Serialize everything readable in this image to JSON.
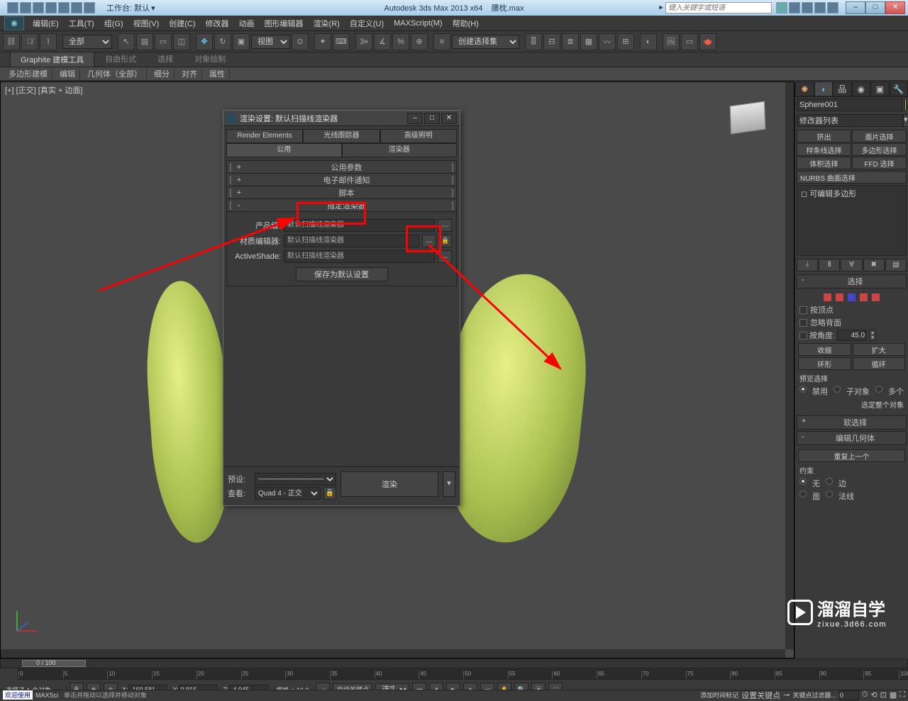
{
  "titlebar": {
    "workspace_label": "工作台: 默认",
    "app": "Autodesk 3ds Max  2013 x64",
    "file": "腰枕.max",
    "search_placeholder": "键入关键字或短语",
    "min": "–",
    "max": "□",
    "close": "✕"
  },
  "menu": [
    "编辑(E)",
    "工具(T)",
    "组(G)",
    "视图(V)",
    "创建(C)",
    "修改器",
    "动画",
    "图形编辑器",
    "渲染(R)",
    "自定义(U)",
    "MAXScript(M)",
    "帮助(H)"
  ],
  "toolbar": {
    "filter_all": "全部",
    "view_label": "视图",
    "create_sel_set": "创建选择集"
  },
  "ribbon": {
    "tabs": [
      "Graphite 建模工具",
      "自由形式",
      "选择",
      "对象绘制"
    ],
    "groups": [
      "多边形建模",
      "编辑",
      "几何体（全部）",
      "细分",
      "对齐",
      "属性"
    ]
  },
  "viewport": {
    "label": "[+] [正交] [真实 + 边面]"
  },
  "cmd": {
    "object_name": "Sphere001",
    "modifier_list": "修改器列表",
    "buttons": [
      "挤出",
      "面片选择",
      "样条线选择",
      "多边形选择",
      "体积选择",
      "FFD 选择"
    ],
    "nurbs": "NURBS 曲面选择",
    "stack_item": "可编辑多边形",
    "rollouts": {
      "selection": "选择",
      "soft": "软选择",
      "editgeo": "编辑几何体"
    },
    "sel": {
      "by_vertex": "按顶点",
      "ignore_back": "忽略背面",
      "by_angle": "按角度:",
      "angle": "45.0",
      "shrink": "收缩",
      "grow": "扩大",
      "ring": "环形",
      "loop": "循环",
      "preview": "预览选择",
      "off": "禁用",
      "subobj": "子对象",
      "multi": "多个",
      "select_whole": "选定整个对象"
    },
    "geo": {
      "repeat": "重复上一个",
      "constraint": "约束",
      "none": "无",
      "edge": "边",
      "face": "面",
      "normal": "法线"
    }
  },
  "dialog": {
    "title": "渲染设置: 默认扫描线渲染器",
    "tabs_top": [
      "Render Elements",
      "光线跟踪器",
      "高级照明"
    ],
    "tabs_bot": [
      "公用",
      "渲染器"
    ],
    "rollouts": [
      "公用参数",
      "电子邮件通知",
      "脚本",
      "指定渲染器"
    ],
    "assign": {
      "production": "产品级:",
      "material": "材质编辑器:",
      "activeshade": "ActiveShade:",
      "default_scanline": "默认扫描线渲染器",
      "save_default": "保存为默认设置"
    },
    "footer": {
      "preset": "预设:",
      "view": "查看:",
      "view_value": "Quad 4 - 正交",
      "render": "渲染"
    }
  },
  "timeline": {
    "frame_label": "0 / 100"
  },
  "status": {
    "selected": "选择了 1 个对象",
    "hint": "单击并拖动以选择并移动对象",
    "x": "-169.581",
    "y": "0.916",
    "z": "-4.945",
    "grid": "栅格 = 10.0",
    "autokey": "自动关键点",
    "setkey": "设置关键点",
    "keyfilter": "关键点过滤器...",
    "sel_dropdown": "选定对",
    "add_time": "添加时间标记",
    "welcome": "欢迎使用",
    "script": "MAXSci"
  },
  "watermark": {
    "main": "溜溜自学",
    "sub": "zixue.3d66.com"
  }
}
